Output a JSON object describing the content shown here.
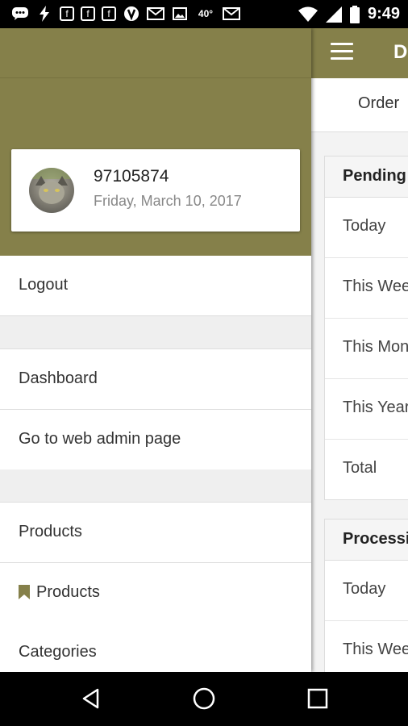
{
  "status_bar": {
    "time": "9:49",
    "temperature": "40°",
    "icons": [
      "message-icon",
      "flash-icon",
      "facebook-icon",
      "facebook-icon",
      "facebook-icon",
      "vine-icon",
      "mail-icon",
      "image-icon",
      "temperature",
      "mail-icon",
      "wifi-icon",
      "signal-icon",
      "battery-icon"
    ]
  },
  "main": {
    "title_initial": "D",
    "tab_label": "Order",
    "cards": [
      {
        "header": "Pending",
        "rows": [
          "Today",
          "This Week",
          "This Month",
          "This Year",
          "Total"
        ]
      },
      {
        "header": "Processing",
        "rows": [
          "Today",
          "This Week"
        ]
      }
    ]
  },
  "drawer": {
    "accent_color": "#85804a",
    "profile": {
      "username": "97105874",
      "date": "Friday, March 10, 2017",
      "avatar_icon": "cat-avatar"
    },
    "items": [
      {
        "label": "Logout"
      },
      {
        "label": "Dashboard"
      },
      {
        "label": "Go to web admin page"
      },
      {
        "label": "Products"
      },
      {
        "label": "Products",
        "icon": "bookmark-icon"
      },
      {
        "label": "Categories"
      }
    ]
  },
  "nav_bar": {
    "buttons": [
      "back-icon",
      "home-icon",
      "recents-icon"
    ]
  }
}
